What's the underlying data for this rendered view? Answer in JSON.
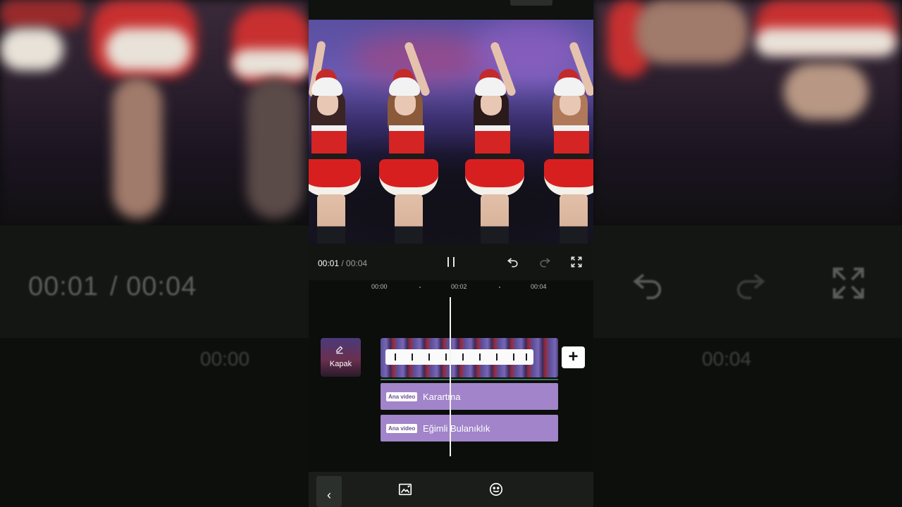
{
  "playback": {
    "current_time": "00:01",
    "separator": " / ",
    "total_time": "00:04"
  },
  "ruler": {
    "ticks": [
      "00:00",
      "00:02",
      "00:04"
    ]
  },
  "timeline": {
    "cover_label": "Kapak",
    "add_clip_symbol": "+",
    "effects": [
      {
        "tag": "Ana video",
        "name": "Karartma"
      },
      {
        "tag": "Ana video",
        "name": "Eğimli Bulanıklık"
      }
    ]
  },
  "bottom_toolbar": {
    "back_symbol": "‹",
    "tools": [
      {
        "icon": "image-effect-icon"
      },
      {
        "icon": "smiley-effect-icon"
      }
    ]
  },
  "background_mirror": {
    "time_current": "00:01",
    "time_total": "/ 00:04",
    "tick_left": "00:00",
    "tick_right": "00:04"
  },
  "colors": {
    "effect_track": "#a184c9",
    "panel_bg": "#0b0e0b",
    "playhead": "#f2f2f2"
  }
}
